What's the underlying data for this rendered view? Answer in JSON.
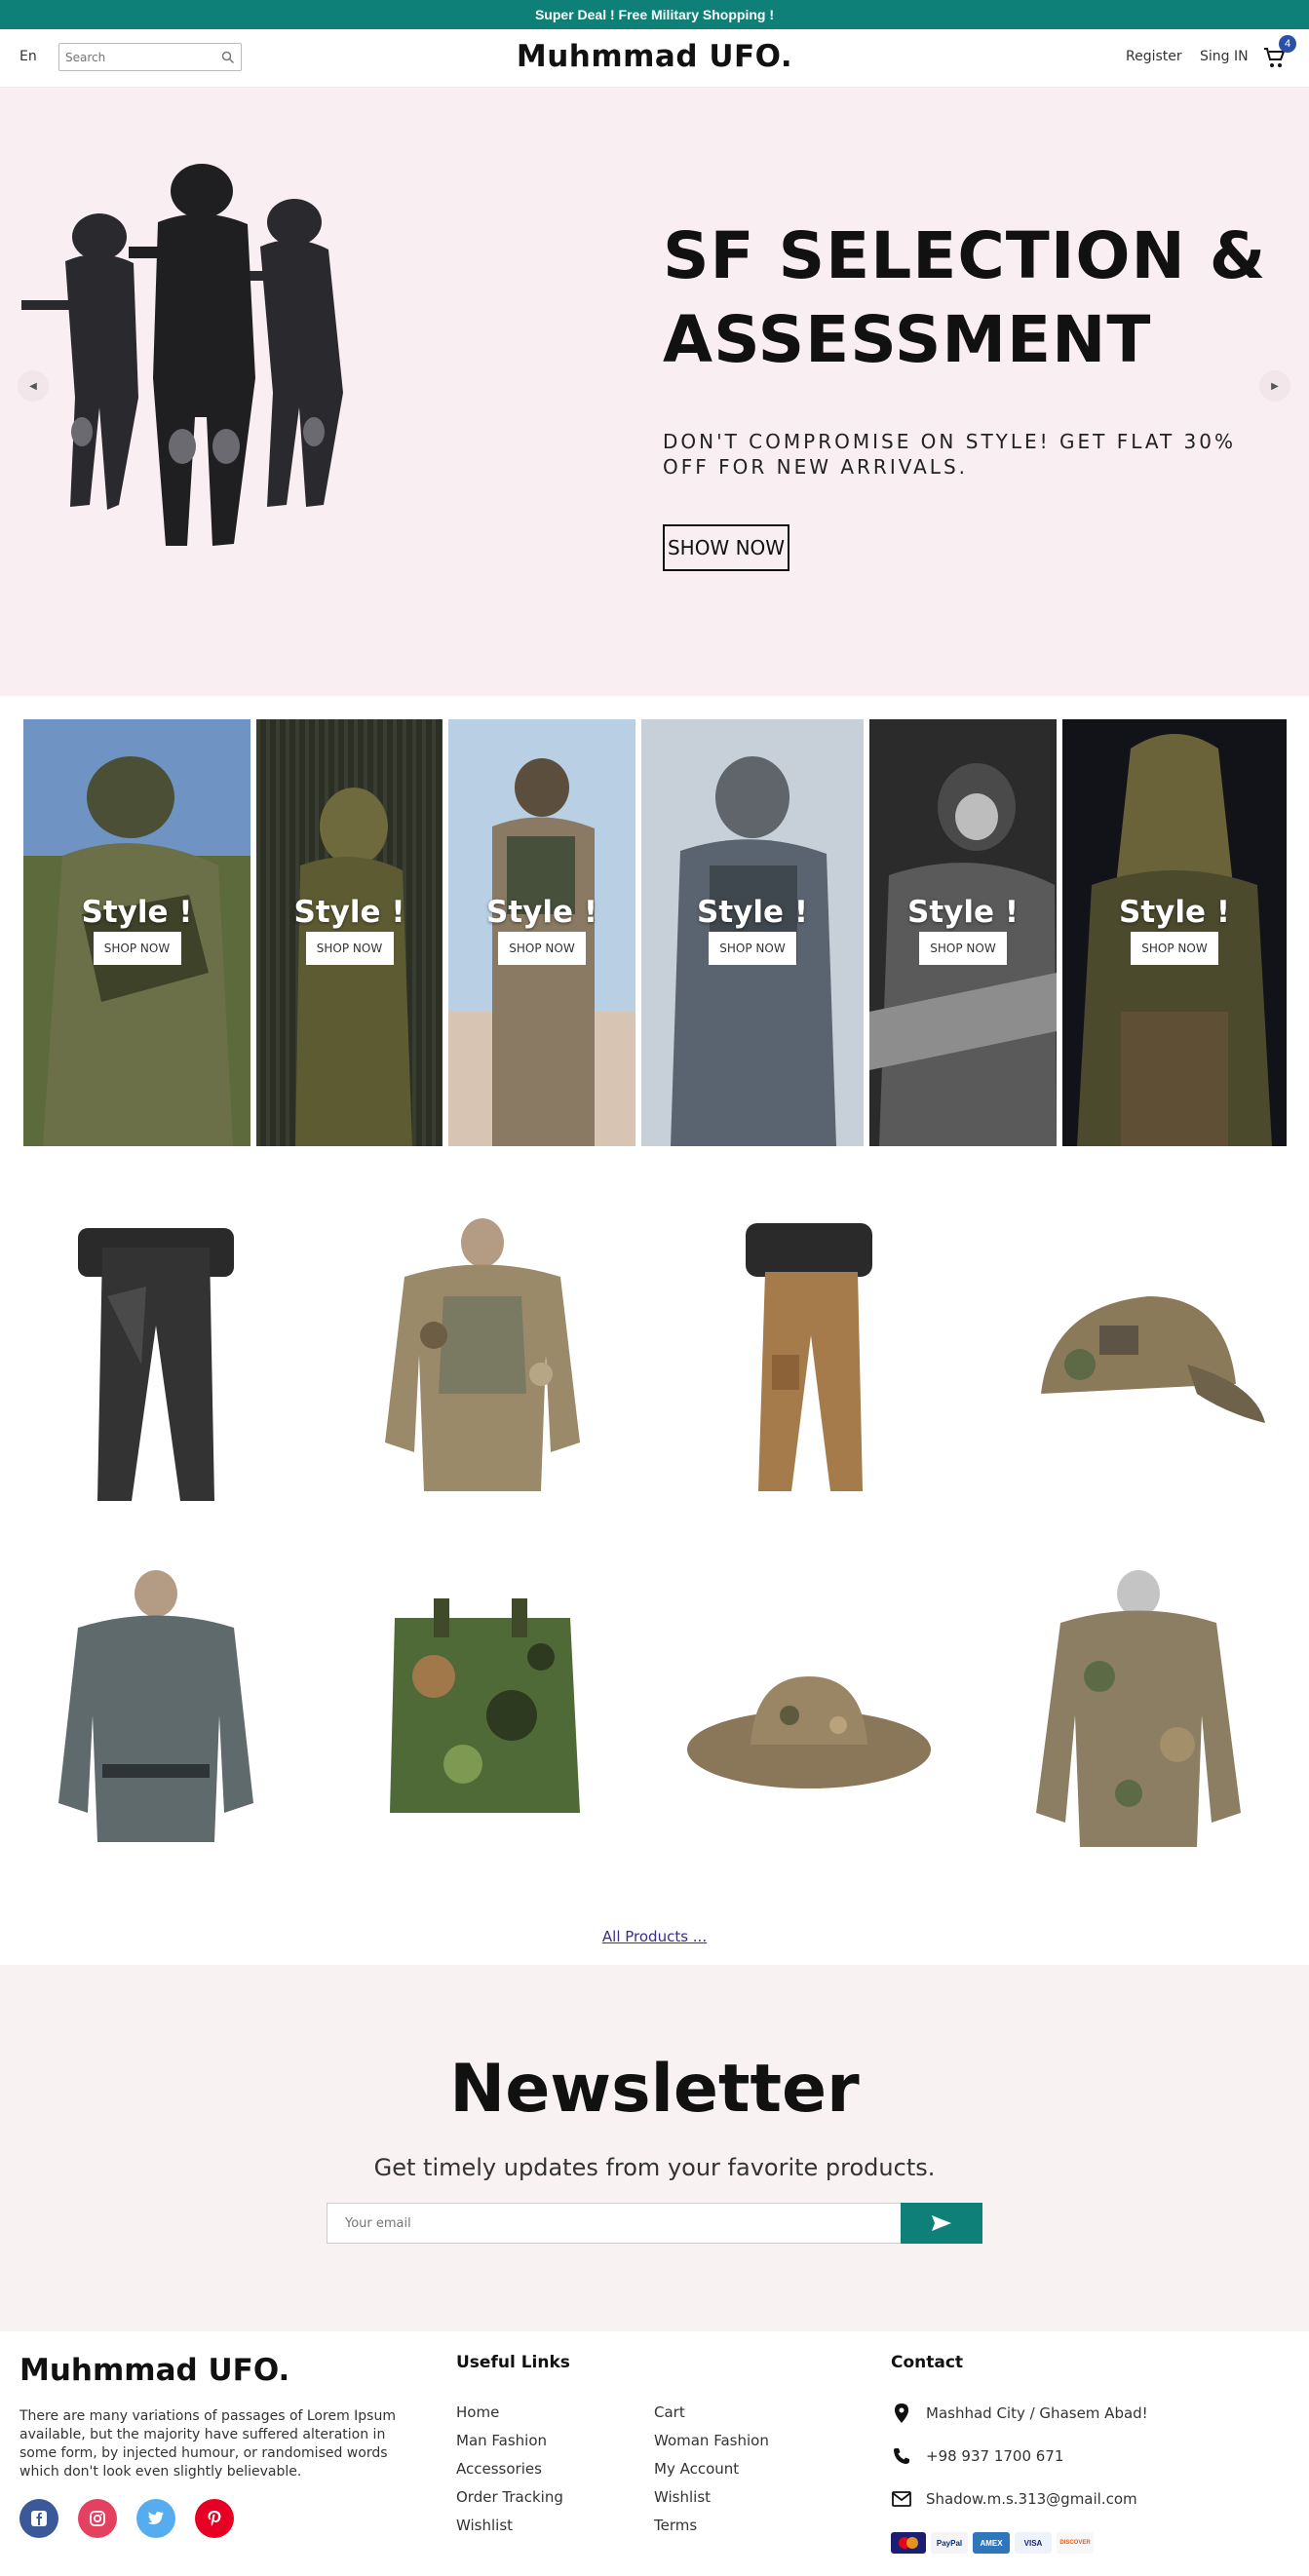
{
  "promo": {
    "text": "Super Deal !   Free Military Shopping !"
  },
  "header": {
    "lang": "En",
    "search_placeholder": "Search",
    "brand": "Muhmmad UFO.",
    "register": "Register",
    "signin": "Sing IN",
    "cart_count": "4"
  },
  "hero": {
    "title": "SF SELECTION & ASSESSMENT",
    "subtitle": "DON'T COMPROMISE ON STYLE! GET FLAT 30% OFF FOR NEW ARRIVALS.",
    "button": "SHOW NOW"
  },
  "style_cards": [
    {
      "title": "Style !",
      "button": "SHOP NOW"
    },
    {
      "title": "Style !",
      "button": "SHOP NOW"
    },
    {
      "title": "Style !",
      "button": "SHOP NOW"
    },
    {
      "title": "Style !",
      "button": "SHOP NOW"
    },
    {
      "title": "Style !",
      "button": "SHOP NOW"
    },
    {
      "title": "Style !",
      "button": "SHOP NOW"
    }
  ],
  "products_link": "All Products ...",
  "newsletter": {
    "title": "Newsletter",
    "subtitle": "Get timely updates from your favorite products.",
    "placeholder": "Your email"
  },
  "footer": {
    "brand": "Muhmmad UFO.",
    "description": "There are many variations of passages of Lorem Ipsum available, but the majority have suffered alteration in some form, by injected humour, or randomised words which don't look even slightly believable.",
    "useful_links_title": "Useful Links",
    "links_col1": [
      "Home",
      "Man Fashion",
      "Accessories",
      "Order Tracking",
      "Wishlist"
    ],
    "links_col2": [
      "Cart",
      "Woman Fashion",
      "My Account",
      "Wishlist",
      "Terms"
    ],
    "contact_title": "Contact",
    "address": "Mashhad City / Ghasem Abad!",
    "phone": "+98 937 1700 671",
    "email": "Shadow.m.s.313@gmail.com",
    "payments": [
      "MasterCard",
      "PayPal",
      "AMEX",
      "VISA",
      "DISCOVER"
    ]
  },
  "colors": {
    "accent": "#0f8078",
    "hero_bg": "#f9eef1",
    "newsletter_bg": "#f9f2f2"
  }
}
